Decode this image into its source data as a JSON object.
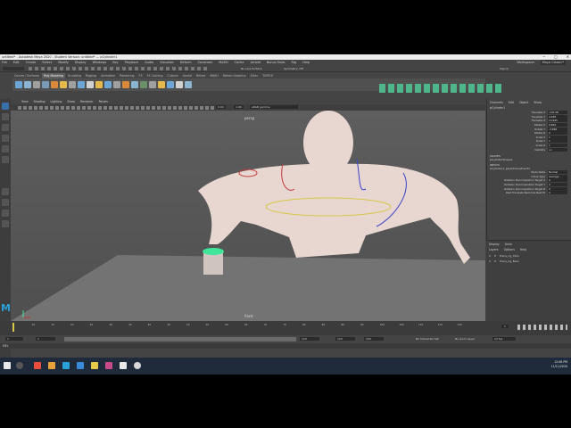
{
  "title_bar": {
    "text": "untitled* - Autodesk Maya 2020 - Student Version: untitled*   ---   pCylinder1"
  },
  "menu": [
    "File",
    "Edit",
    "Create",
    "Select",
    "Modify",
    "Display",
    "Windows",
    "Key",
    "Playback",
    "Audio",
    "Visualize",
    "Deform",
    "Constrain",
    "MASH",
    "Cache",
    "Arnold",
    "Bonus Tools",
    "Rig",
    "Help"
  ],
  "status": {
    "workspace_label": "Workspace:",
    "workspace_value": "Maya Classic*",
    "sign_in": "Sign In",
    "no_live_surface": "No Live Surface",
    "symmetry": "Symmetry: Off"
  },
  "shelf_tabs": [
    "Curves / Surfaces",
    "Poly Modeling",
    "Sculpting",
    "Rigging",
    "Animation",
    "Rendering",
    "FX",
    "FX Caching",
    "Custom",
    "Arnold",
    "Bifrost",
    "MASH",
    "Motion Graphics",
    "XGen",
    "TURTLE"
  ],
  "active_shelf_tab": "Poly Modeling",
  "panel_menu": [
    "View",
    "Shading",
    "Lighting",
    "Show",
    "Renderer",
    "Panels"
  ],
  "viewport": {
    "exposure": "0.00",
    "gamma": "1.00",
    "color_space": "sRGB gamma",
    "label_persp": "persp",
    "label_front": "front"
  },
  "channel_box": {
    "tabs": [
      "Channels",
      "Edit",
      "Object",
      "Show"
    ],
    "object_name": "pCylinder1",
    "attributes": [
      {
        "name": "Translate X",
        "value": "-102.38"
      },
      {
        "name": "Translate Y",
        "value": "4.268"
      },
      {
        "name": "Translate Z",
        "value": "13.695"
      },
      {
        "name": "Rotate X",
        "value": "0.899"
      },
      {
        "name": "Rotate Y",
        "value": "-3.998"
      },
      {
        "name": "Rotate Z",
        "value": "0"
      },
      {
        "name": "Scale X",
        "value": "1"
      },
      {
        "name": "Scale Y",
        "value": "1"
      },
      {
        "name": "Scale Z",
        "value": "1"
      },
      {
        "name": "Visibility",
        "value": "on"
      }
    ],
    "shapes_label": "SHAPES",
    "shape_name": "pCylinderShape1",
    "inputs_label": "INPUTS",
    "input_name": "pCylinder1_parentConstraint1",
    "input_attributes": [
      {
        "name": "Node State",
        "value": "Normal"
      },
      {
        "name": "Interp Type",
        "value": "Average"
      },
      {
        "name": "Rotation Decomposition Target X",
        "value": "0"
      },
      {
        "name": "Rotation Decomposition Target Y",
        "value": "0"
      },
      {
        "name": "Rotation Decomposition Target Z",
        "value": "0"
      },
      {
        "name": "Rest Translate Rest Axis Rest W",
        "value": "0"
      }
    ]
  },
  "layers": {
    "tabs": [
      "Display",
      "Anim"
    ],
    "menu": [
      "Layers",
      "Options",
      "Help"
    ],
    "items": [
      {
        "v": "V",
        "p": "P",
        "name": "Trans_rig_Ctrls"
      },
      {
        "v": "V",
        "p": "P",
        "name": "Trans_rig_Bars"
      }
    ]
  },
  "timeline": {
    "ticks": [
      "5",
      "10",
      "15",
      "20",
      "25",
      "30",
      "35",
      "40",
      "45",
      "50",
      "55",
      "60",
      "65",
      "70",
      "75",
      "80",
      "85",
      "90",
      "95",
      "100",
      "105",
      "110",
      "115",
      "120"
    ],
    "current_frame": "1"
  },
  "range": {
    "start": "1",
    "inner_start": "1",
    "inner_end": "120",
    "end_a": "120",
    "end_b": "200",
    "fps": "24 fps",
    "character_set": "No Character Set",
    "anim_layer": "No Anim Layer"
  },
  "mel_label": "MEL",
  "taskbar": {
    "time": "12:08 PM",
    "date": "11/11/2020"
  },
  "colors": {
    "maya_blue": "#2aa0d8",
    "selection_green": "#3fe69a",
    "control_red": "#c23a3a",
    "control_blue": "#3a45c8",
    "control_yellow": "#d8c84a",
    "character_skin": "#e8d6d0",
    "ground": "#737373"
  },
  "icons": [
    "select-tool-icon",
    "lasso-icon",
    "paint-icon",
    "move-icon",
    "rotate-icon",
    "scale-icon",
    "maya-logo-icon",
    "windows-start-icon",
    "search-icon"
  ]
}
